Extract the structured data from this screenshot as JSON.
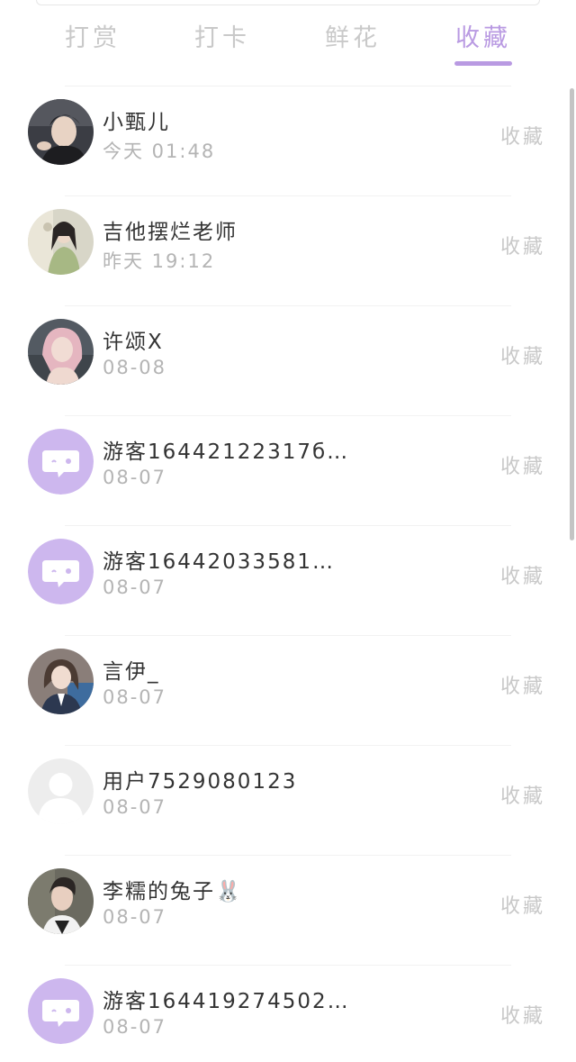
{
  "accent_color": "#b99ae2",
  "tabs": [
    {
      "label": "打赏",
      "active": false
    },
    {
      "label": "打卡",
      "active": false
    },
    {
      "label": "鲜花",
      "active": false
    },
    {
      "label": "收藏",
      "active": true
    }
  ],
  "items": [
    {
      "name": "小甄儿",
      "time": "今天 01:48",
      "action": "收藏",
      "avatar": "photo-dark-hair"
    },
    {
      "name": "吉他摆烂老师",
      "time": "昨天 19:12",
      "action": "收藏",
      "avatar": "photo-green-dress"
    },
    {
      "name": "许颂X",
      "time": "08-08",
      "action": "收藏",
      "avatar": "photo-pink-hair"
    },
    {
      "name": "游客16442122317б…",
      "time": "08-07",
      "action": "收藏",
      "avatar": "guest-chat-icon"
    },
    {
      "name": "游客16442033581…",
      "time": "08-07",
      "action": "收藏",
      "avatar": "guest-chat-icon"
    },
    {
      "name": "言伊_",
      "time": "08-07",
      "action": "收藏",
      "avatar": "photo-school-uniform"
    },
    {
      "name": "用户7529080123",
      "time": "08-07",
      "action": "收藏",
      "avatar": "default-user-icon"
    },
    {
      "name": "李糯的兔子🐰",
      "time": "08-07",
      "action": "收藏",
      "avatar": "photo-young-man"
    },
    {
      "name": "游客164419274502…",
      "time": "08-07",
      "action": "收藏",
      "avatar": "guest-chat-icon"
    }
  ]
}
